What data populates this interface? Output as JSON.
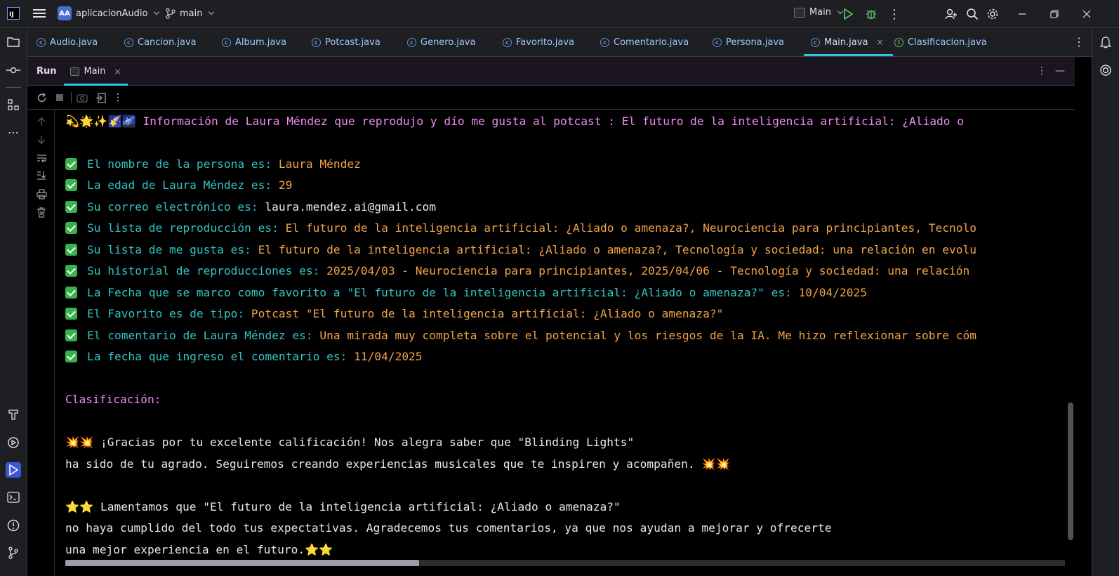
{
  "titlebar": {
    "project_initials": "AA",
    "project_name": "aplicacionAudio",
    "branch": "main",
    "run_config": "Main"
  },
  "editor_tabs": [
    {
      "label": "Audio.java",
      "type": "class",
      "active": false
    },
    {
      "label": "Cancion.java",
      "type": "class",
      "active": false
    },
    {
      "label": "Album.java",
      "type": "class",
      "active": false
    },
    {
      "label": "Potcast.java",
      "type": "class",
      "active": false
    },
    {
      "label": "Genero.java",
      "type": "class",
      "active": false
    },
    {
      "label": "Favorito.java",
      "type": "class",
      "active": false
    },
    {
      "label": "Comentario.java",
      "type": "class",
      "active": false
    },
    {
      "label": "Persona.java",
      "type": "class",
      "active": false
    },
    {
      "label": "Main.java",
      "type": "class",
      "active": true,
      "close": "×"
    },
    {
      "label": "Clasificacion.java",
      "type": "interface",
      "active": false
    }
  ],
  "run_panel": {
    "title": "Run",
    "tab_label": "Main",
    "tab_close": "×"
  },
  "console": {
    "header_emojis": "💫🌟✨🌠🌌",
    "header_text": "Información de Laura Méndez que reprodujo y dío me gusta al potcast : El futuro de la inteligencia artificial: ¿Aliado o",
    "rows": [
      {
        "label": "El nombre de la persona es: ",
        "value": "Laura Méndez"
      },
      {
        "label": "La edad de Laura Méndez es: ",
        "value": "29"
      },
      {
        "label": "Su correo electrónico es: ",
        "value": "laura.mendez.ai@gmail.com"
      },
      {
        "label": "Su lista de reproducción es: ",
        "value": "El futuro de la inteligencia artificial: ¿Aliado o amenaza?, Neurociencia para principiantes, Tecnolo"
      },
      {
        "label": "Su lista de me gusta es: ",
        "value": "El futuro de la inteligencia artificial: ¿Aliado o amenaza?, Tecnología y sociedad: una relación en evolu"
      },
      {
        "label": "Su historial de reproducciones es: ",
        "value": "2025/04/03 - Neurociencia para principiantes, 2025/04/06 - Tecnología y sociedad: una relación"
      },
      {
        "label": "La Fecha que se marco como favorito a \"El futuro de la inteligencia artificial: ¿Aliado o amenaza?\" es: ",
        "value": "10/04/2025"
      },
      {
        "label": "El Favorito es de tipo: ",
        "value": "Potcast \"El futuro de la inteligencia artificial: ¿Aliado o amenaza?\""
      },
      {
        "label": "El comentario de Laura Méndez es: ",
        "value": "Una mirada muy completa sobre el potencial y los riesgos de la IA. Me hizo reflexionar sobre cóm"
      },
      {
        "label": "La fecha que ingreso el comentario es: ",
        "value": "11/04/2025"
      }
    ],
    "clasificacion_heading": "Clasificación:",
    "msg1_emojis_start": "💥💥",
    "msg1_line1": " ¡Gracias por tu excelente calificación! Nos alegra saber que \"Blinding Lights\"",
    "msg1_line2": "ha sido de tu agrado. Seguiremos creando experiencias musicales que te inspiren y acompañen. ",
    "msg1_emojis_end": "💥💥",
    "msg2_emojis_start": "⭐⭐",
    "msg2_line1": " Lamentamos que \"El futuro de la inteligencia artificial: ¿Aliado o amenaza?\"",
    "msg2_line2": "no haya cumplido del todo tus expectativas. Agradecemos tus comentarios, ya que nos ayudan a mejorar y ofrecerte",
    "msg2_line3": "una mejor experiencia en el futuro.",
    "msg2_emojis_end": "⭐⭐"
  },
  "icons": {
    "more": "⋮",
    "minimize": "—"
  }
}
